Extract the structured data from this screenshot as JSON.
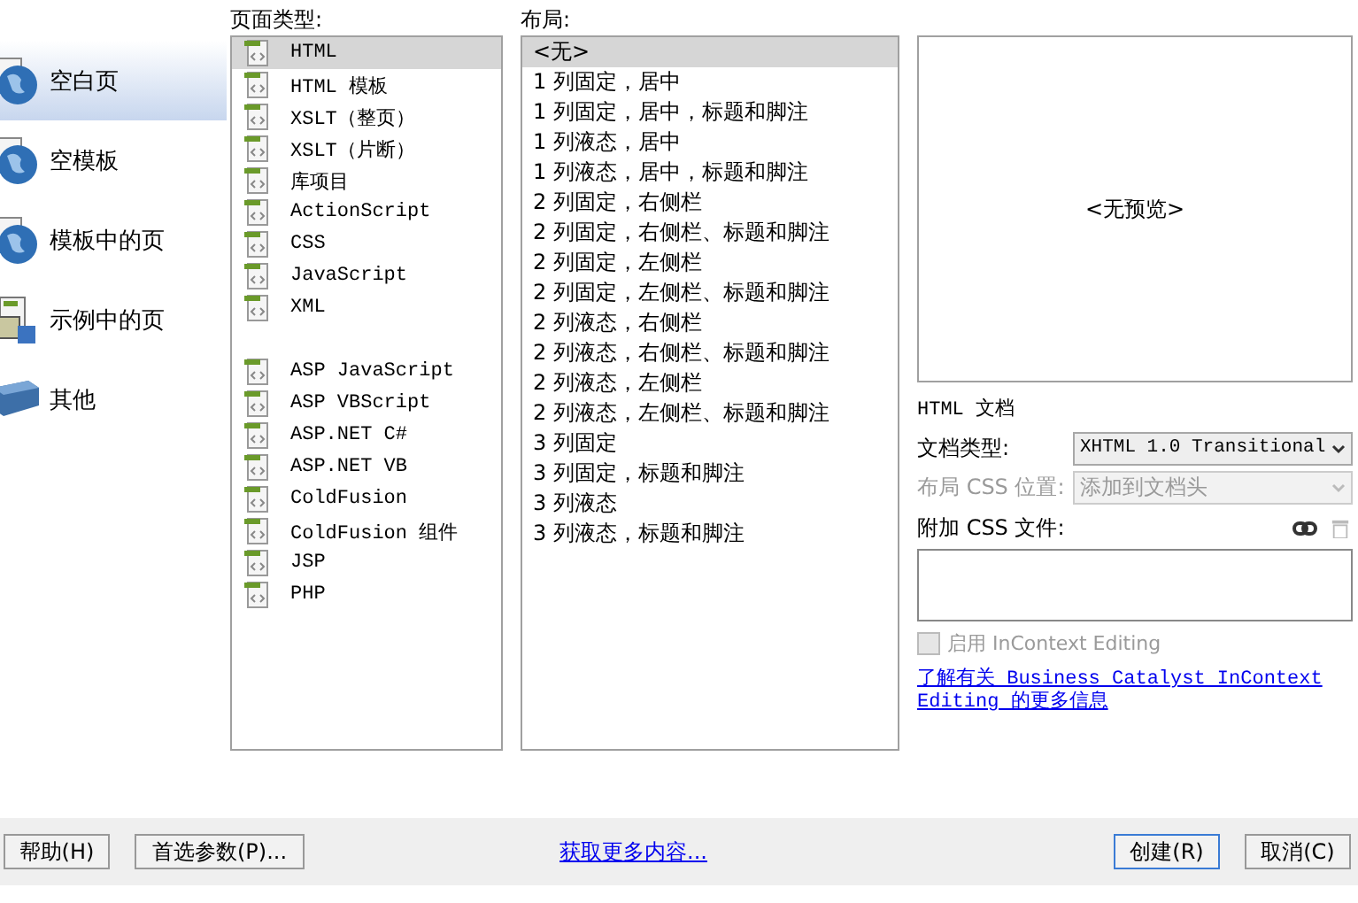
{
  "categories": [
    {
      "label": "空白页",
      "kind": "globe",
      "selected": true
    },
    {
      "label": "空模板",
      "kind": "globe",
      "selected": false
    },
    {
      "label": "模板中的页",
      "kind": "globe",
      "selected": false
    },
    {
      "label": "示例中的页",
      "kind": "sample",
      "selected": false
    },
    {
      "label": "其他",
      "kind": "other",
      "selected": false
    }
  ],
  "page_type": {
    "label": "页面类型:",
    "groups": [
      [
        {
          "label": "HTML",
          "selected": true
        },
        {
          "label": "HTML 模板",
          "selected": false
        },
        {
          "label": "XSLT（整页）",
          "selected": false
        },
        {
          "label": "XSLT（片断）",
          "selected": false
        },
        {
          "label": "库项目",
          "selected": false
        },
        {
          "label": "ActionScript",
          "selected": false
        },
        {
          "label": "CSS",
          "selected": false
        },
        {
          "label": "JavaScript",
          "selected": false
        },
        {
          "label": "XML",
          "selected": false
        }
      ],
      [
        {
          "label": "ASP JavaScript",
          "selected": false
        },
        {
          "label": "ASP VBScript",
          "selected": false
        },
        {
          "label": "ASP.NET C#",
          "selected": false
        },
        {
          "label": "ASP.NET VB",
          "selected": false
        },
        {
          "label": "ColdFusion",
          "selected": false
        },
        {
          "label": "ColdFusion 组件",
          "selected": false
        },
        {
          "label": "JSP",
          "selected": false
        },
        {
          "label": "PHP",
          "selected": false
        }
      ]
    ]
  },
  "layout": {
    "label": "布局:",
    "items": [
      {
        "label": "<无>",
        "selected": true
      },
      {
        "label": "1 列固定，居中",
        "selected": false
      },
      {
        "label": "1 列固定，居中，标题和脚注",
        "selected": false
      },
      {
        "label": "1 列液态，居中",
        "selected": false
      },
      {
        "label": "1 列液态，居中，标题和脚注",
        "selected": false
      },
      {
        "label": "2 列固定，右侧栏",
        "selected": false
      },
      {
        "label": "2 列固定，右侧栏、标题和脚注",
        "selected": false
      },
      {
        "label": "2 列固定，左侧栏",
        "selected": false
      },
      {
        "label": "2 列固定，左侧栏、标题和脚注",
        "selected": false
      },
      {
        "label": "2 列液态，右侧栏",
        "selected": false
      },
      {
        "label": "2 列液态，右侧栏、标题和脚注",
        "selected": false
      },
      {
        "label": "2 列液态，左侧栏",
        "selected": false
      },
      {
        "label": "2 列液态，左侧栏、标题和脚注",
        "selected": false
      },
      {
        "label": "3 列固定",
        "selected": false
      },
      {
        "label": "3 列固定，标题和脚注",
        "selected": false
      },
      {
        "label": "3 列液态",
        "selected": false
      },
      {
        "label": "3 列液态，标题和脚注",
        "selected": false
      }
    ]
  },
  "preview": {
    "text": "<无预览>",
    "description": "HTML 文档"
  },
  "doctype": {
    "label": "文档类型:",
    "value": "XHTML 1.0 Transitional",
    "disabled": false
  },
  "layout_css": {
    "label": "布局 CSS 位置:",
    "value": "添加到文档头",
    "disabled": true
  },
  "attach_css": {
    "label": "附加 CSS 文件:"
  },
  "incontext": {
    "label": "启用 InContext Editing",
    "checked": false,
    "disabled": true
  },
  "info_link": "了解有关 Business Catalyst InContext Editing 的更多信息",
  "buttons": {
    "help": "帮助(H)",
    "preferences": "首选参数(P)...",
    "get_more": "获取更多内容...",
    "create": "创建(R)",
    "cancel": "取消(C)"
  }
}
